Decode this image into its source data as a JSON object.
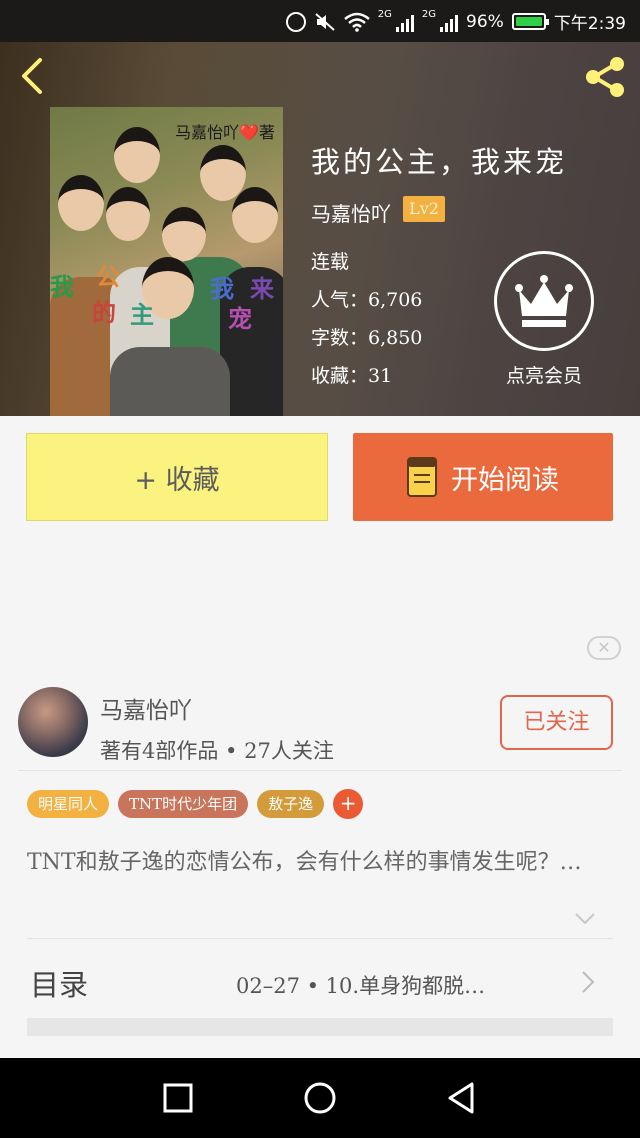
{
  "status_bar": {
    "network": "2G",
    "battery": "96%",
    "time": "下午2:39"
  },
  "header": {
    "back_icon": "chevron-left-icon",
    "share_icon": "share-icon"
  },
  "cover": {
    "author_tag": "马嘉怡吖❤️著",
    "title_chars": [
      "我",
      "的",
      "公",
      "主",
      "我",
      "来",
      "宠"
    ]
  },
  "book": {
    "title": "我的公主，我来宠",
    "author": "马嘉怡吖",
    "level": "Lv2",
    "status": "连载",
    "popularity": "人气：6,706",
    "word_count": "字数：6,850",
    "favorites": "收藏：31"
  },
  "vip": {
    "icon": "crown-icon",
    "label": "点亮会员"
  },
  "actions": {
    "collect_label": "+ 收藏",
    "read_label": "开始阅读"
  },
  "close_icon": "close-icon",
  "author_card": {
    "name": "马嘉怡吖",
    "stats": "著有4部作品 • 27人关注",
    "follow_label": "已关注"
  },
  "tags": [
    {
      "label": "明星同人",
      "color": "#f2b140"
    },
    {
      "label": "TNT时代少年团",
      "color": "#c9755b"
    },
    {
      "label": "敖子逸",
      "color": "#d49b3b"
    }
  ],
  "tag_add": "+",
  "description": "TNT和敖子逸的恋情公布，会有什么样的事情发生呢？…",
  "toc": {
    "label": "目录",
    "latest": "02–27 • 10.单身狗都脱…"
  },
  "colors": {
    "accent": "#ea6a3e",
    "collect_bg": "#fbf37f",
    "lv_badge": "#f2b140"
  }
}
